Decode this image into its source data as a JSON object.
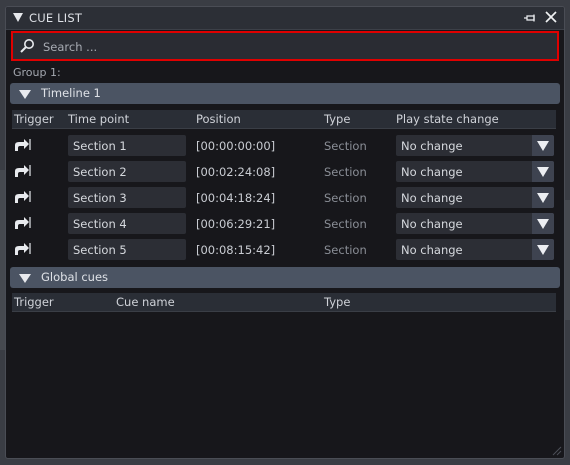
{
  "window": {
    "title": "CUE LIST",
    "pin_icon": "pin-icon",
    "close_icon": "close-icon"
  },
  "search": {
    "placeholder": "Search ...",
    "value": "",
    "icon": "search-icon"
  },
  "group_label": "Group 1:",
  "timeline": {
    "title": "Timeline 1",
    "columns": {
      "trigger": "Trigger",
      "time_point": "Time point",
      "position": "Position",
      "type": "Type",
      "play_state": "Play state change"
    },
    "rows": [
      {
        "time_point": "Section 1",
        "position": "[00:00:00:00]",
        "type": "Section",
        "play_state": "No change"
      },
      {
        "time_point": "Section 2",
        "position": "[00:02:24:08]",
        "type": "Section",
        "play_state": "No change"
      },
      {
        "time_point": "Section 3",
        "position": "[00:04:18:24]",
        "type": "Section",
        "play_state": "No change"
      },
      {
        "time_point": "Section 4",
        "position": "[00:06:29:21]",
        "type": "Section",
        "play_state": "No change"
      },
      {
        "time_point": "Section 5",
        "position": "[00:08:15:42]",
        "type": "Section",
        "play_state": "No change"
      }
    ]
  },
  "global_cues": {
    "title": "Global cues",
    "columns": {
      "trigger": "Trigger",
      "cue_name": "Cue name",
      "type": "Type"
    }
  },
  "colors": {
    "highlight": "#e00000",
    "section_header": "#4b5463",
    "panel_bg": "#17171b"
  }
}
